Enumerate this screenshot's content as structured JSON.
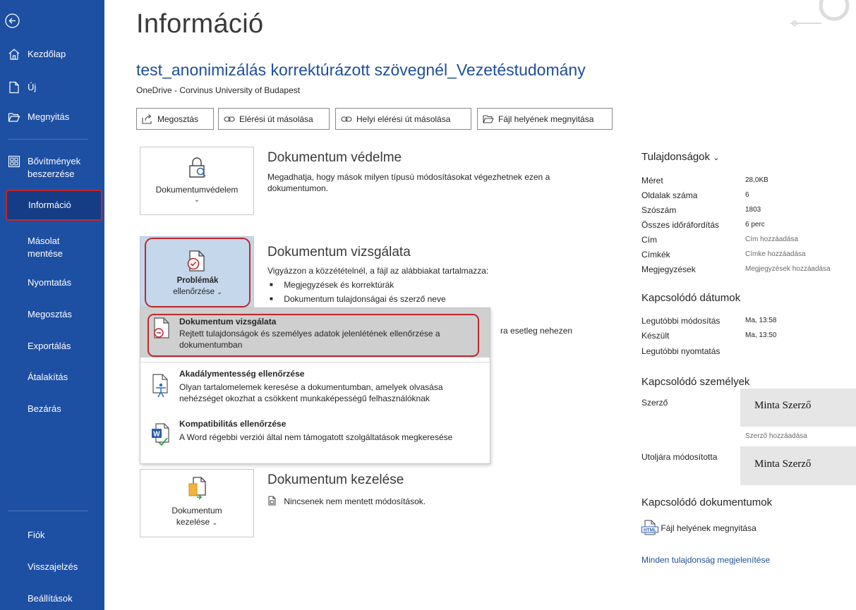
{
  "sidebar": {
    "items": [
      {
        "label": "Kezdőlap",
        "icon": "home-icon"
      },
      {
        "label": "Új",
        "icon": "new-document-icon"
      },
      {
        "label": "Megnyitás",
        "icon": "open-folder-icon"
      },
      {
        "label": "Bővítmények beszerzése",
        "line1": "Bővítmények",
        "line2": "beszerzése",
        "icon": "addins-grid-icon"
      },
      {
        "label": "Információ"
      },
      {
        "label": "Másolat mentése",
        "line1": "Másolat",
        "line2": "mentése"
      },
      {
        "label": "Nyomtatás"
      },
      {
        "label": "Megosztás"
      },
      {
        "label": "Exportálás"
      },
      {
        "label": "Átalakítás"
      },
      {
        "label": "Bezárás"
      }
    ],
    "bottom": [
      {
        "label": "Fiók"
      },
      {
        "label": "Visszajelzés"
      },
      {
        "label": "Beállítások"
      }
    ],
    "back_icon": "back-arrow-icon",
    "accent": "#1d4fa3",
    "highlight_border": "#c0272d"
  },
  "page": {
    "title": "Információ",
    "doc_title": "test_anonimizálás korrektúrázott szövegnél_Vezetéstudomány",
    "doc_location": "OneDrive - Corvinus University of Budapest"
  },
  "actions": [
    {
      "label": "Megosztás",
      "icon": "share-icon"
    },
    {
      "label": "Elérési út másolása",
      "icon": "link-icon"
    },
    {
      "label": "Helyi elérési út másolása",
      "icon": "link-icon"
    },
    {
      "label": "Fájl helyének megnyitása",
      "icon": "folder-icon"
    }
  ],
  "sections": {
    "protect": {
      "tile_label": "Dokumentumvédelem",
      "title": "Dokumentum védelme",
      "text": "Megadhatja, hogy mások milyen típusú módosításokat végezhetnek ezen a dokumentumon."
    },
    "inspect": {
      "tile_line1": "Problémák",
      "tile_line2": "ellenőrzése",
      "title": "Dokumentum vizsgálata",
      "intro": "Vigyázzon a közzétételnél, a fájl az alábbiakat tartalmazza:",
      "bullets": [
        "Megjegyzések és korrektúrák",
        "Dokumentum tulajdonságai és szerző neve"
      ],
      "hidden_text": "ra esetleg nehezen"
    },
    "manage": {
      "tile_line1": "Dokumentum",
      "tile_line2": "kezelése",
      "title": "Dokumentum kezelése",
      "text": "Nincsenek nem mentett módosítások."
    }
  },
  "dropdown": {
    "items": [
      {
        "title": "Dokumentum vizsgálata",
        "desc": "Rejtett tulajdonságok és személyes adatok jelenlétének ellenőrzése a dokumentumban",
        "icon": "inspect-document-icon"
      },
      {
        "title": "Akadálymentesség ellenőrzése",
        "desc": "Olyan tartalomelemek keresése a dokumentumban, amelyek olvasása nehézséget okozhat a csökkent munkaképességű felhasználóknak",
        "icon": "accessibility-icon"
      },
      {
        "title": "Kompatibilitás ellenőrzése",
        "desc": "A Word régebbi verziói által nem támogatott szolgáltatások megkeresése",
        "icon": "word-compatibility-icon"
      }
    ]
  },
  "properties": {
    "heading": "Tulajdonságok",
    "rows": [
      {
        "key": "Méret",
        "value": "28,0KB"
      },
      {
        "key": "Oldalak száma",
        "value": "6"
      },
      {
        "key": "Szószám",
        "value": "1803"
      },
      {
        "key": "Összes időráfordítás",
        "value": "6 perc"
      },
      {
        "key": "Cím",
        "value": "Cím hozzáadása"
      },
      {
        "key": "Címkék",
        "value": "Címke hozzáadása"
      },
      {
        "key": "Megjegyzések",
        "value": "Megjegyzések hozzáadása"
      }
    ]
  },
  "dates": {
    "heading": "Kapcsolódó dátumok",
    "rows": [
      {
        "key": "Legutóbbi módosítás",
        "value": "Ma, 13:58"
      },
      {
        "key": "Készült",
        "value": "Ma, 13:50"
      },
      {
        "key": "Legutóbbi nyomtatás",
        "value": ""
      }
    ]
  },
  "people": {
    "heading": "Kapcsolódó személyek",
    "author_label": "Szerző",
    "author_name": "Minta Szerző",
    "add_author": "Szerző hozzáadása",
    "modified_label": "Utoljára módosította",
    "modified_name": "Minta Szerző"
  },
  "related_docs": {
    "heading": "Kapcsolódó dokumentumok",
    "open_location": "Fájl helyének megnyitása",
    "show_all": "Minden tulajdonság megjelenítése"
  }
}
